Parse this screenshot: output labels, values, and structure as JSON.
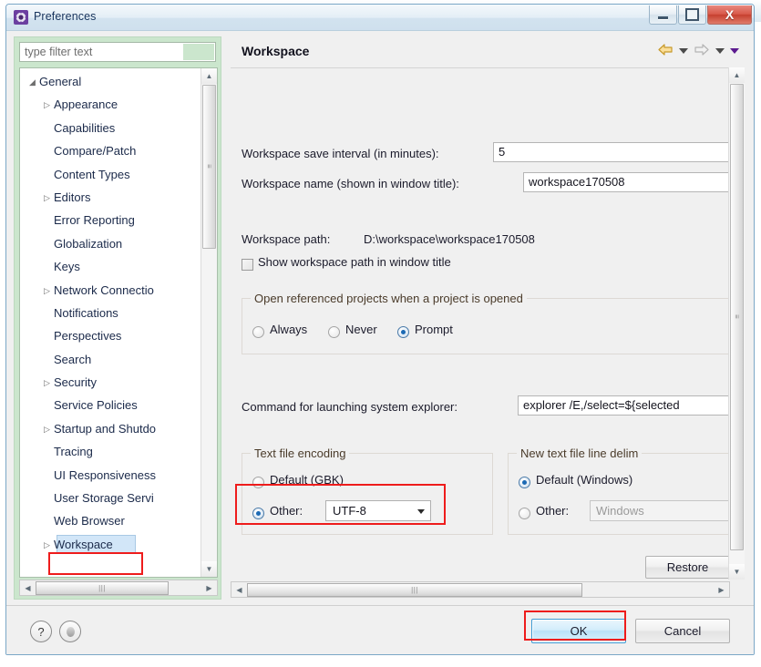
{
  "window": {
    "title": "Preferences",
    "icon": "gear-icon",
    "controls": {
      "minimize": "minimize-icon",
      "maximize": "maximize-icon",
      "close": "X"
    }
  },
  "filter": {
    "placeholder": "type filter text",
    "value": ""
  },
  "tree": {
    "items": [
      {
        "label": "General",
        "level": 0,
        "arrow": "expanded",
        "selected": false
      },
      {
        "label": "Appearance",
        "level": 1,
        "arrow": "collapsed",
        "selected": false
      },
      {
        "label": "Capabilities",
        "level": 1,
        "arrow": "none",
        "selected": false
      },
      {
        "label": "Compare/Patch",
        "level": 1,
        "arrow": "none",
        "selected": false
      },
      {
        "label": "Content Types",
        "level": 1,
        "arrow": "none",
        "selected": false
      },
      {
        "label": "Editors",
        "level": 1,
        "arrow": "collapsed",
        "selected": false
      },
      {
        "label": "Error Reporting",
        "level": 1,
        "arrow": "none",
        "selected": false
      },
      {
        "label": "Globalization",
        "level": 1,
        "arrow": "none",
        "selected": false
      },
      {
        "label": "Keys",
        "level": 1,
        "arrow": "none",
        "selected": false
      },
      {
        "label": "Network Connectio",
        "level": 1,
        "arrow": "collapsed",
        "selected": false
      },
      {
        "label": "Notifications",
        "level": 1,
        "arrow": "none",
        "selected": false
      },
      {
        "label": "Perspectives",
        "level": 1,
        "arrow": "none",
        "selected": false
      },
      {
        "label": "Search",
        "level": 1,
        "arrow": "none",
        "selected": false
      },
      {
        "label": "Security",
        "level": 1,
        "arrow": "collapsed",
        "selected": false
      },
      {
        "label": "Service Policies",
        "level": 1,
        "arrow": "none",
        "selected": false
      },
      {
        "label": "Startup and Shutdo",
        "level": 1,
        "arrow": "collapsed",
        "selected": false
      },
      {
        "label": "Tracing",
        "level": 1,
        "arrow": "none",
        "selected": false
      },
      {
        "label": "UI Responsiveness",
        "level": 1,
        "arrow": "none",
        "selected": false
      },
      {
        "label": "User Storage Servi",
        "level": 1,
        "arrow": "none",
        "selected": false
      },
      {
        "label": "Web Browser",
        "level": 1,
        "arrow": "none",
        "selected": false
      },
      {
        "label": "Workspace",
        "level": 1,
        "arrow": "collapsed",
        "selected": true
      }
    ]
  },
  "page": {
    "title": "Workspace",
    "nav": {
      "back": "back-arrow",
      "back_menu": "caret",
      "forward": "forward-arrow",
      "forward_menu": "caret",
      "view_menu": "caret"
    },
    "save_interval": {
      "label": "Workspace save interval (in minutes):",
      "value": "5"
    },
    "workspace_name": {
      "label": "Workspace name (shown in window title):",
      "value": "workspace170508"
    },
    "workspace_path": {
      "label": "Workspace path:",
      "value": "D:\\workspace\\workspace170508"
    },
    "show_path_checkbox": {
      "label": "Show workspace path in window title",
      "checked": false
    },
    "open_referenced": {
      "group_title": "Open referenced projects when a project is opened",
      "options": [
        {
          "label": "Always",
          "selected": false
        },
        {
          "label": "Never",
          "selected": false
        },
        {
          "label": "Prompt",
          "selected": true
        }
      ]
    },
    "explorer_command": {
      "label": "Command for launching system explorer:",
      "value": "explorer /E,/select=${selected"
    },
    "text_file_encoding": {
      "group_title": "Text file encoding",
      "default_option": {
        "label": "Default (GBK)",
        "selected": false
      },
      "other_option": {
        "label": "Other:",
        "selected": true
      },
      "combo_value": "UTF-8"
    },
    "line_delimiter": {
      "group_title": "New text file line delim",
      "default_option": {
        "label": "Default (Windows)",
        "selected": true
      },
      "other_option": {
        "label": "Other:",
        "selected": false
      },
      "combo_value": "Windows"
    },
    "restore_button": "Restore"
  },
  "footer": {
    "help_icon": "?",
    "apply_icon": "circle-icon",
    "ok_button": "OK",
    "cancel_button": "Cancel"
  },
  "colors": {
    "accent_blue": "#3c9bd4",
    "annotation_red": "#ee1c1c",
    "filter_panel_green": "#cbe6cd",
    "selection_blue": "#d2e6f8"
  }
}
